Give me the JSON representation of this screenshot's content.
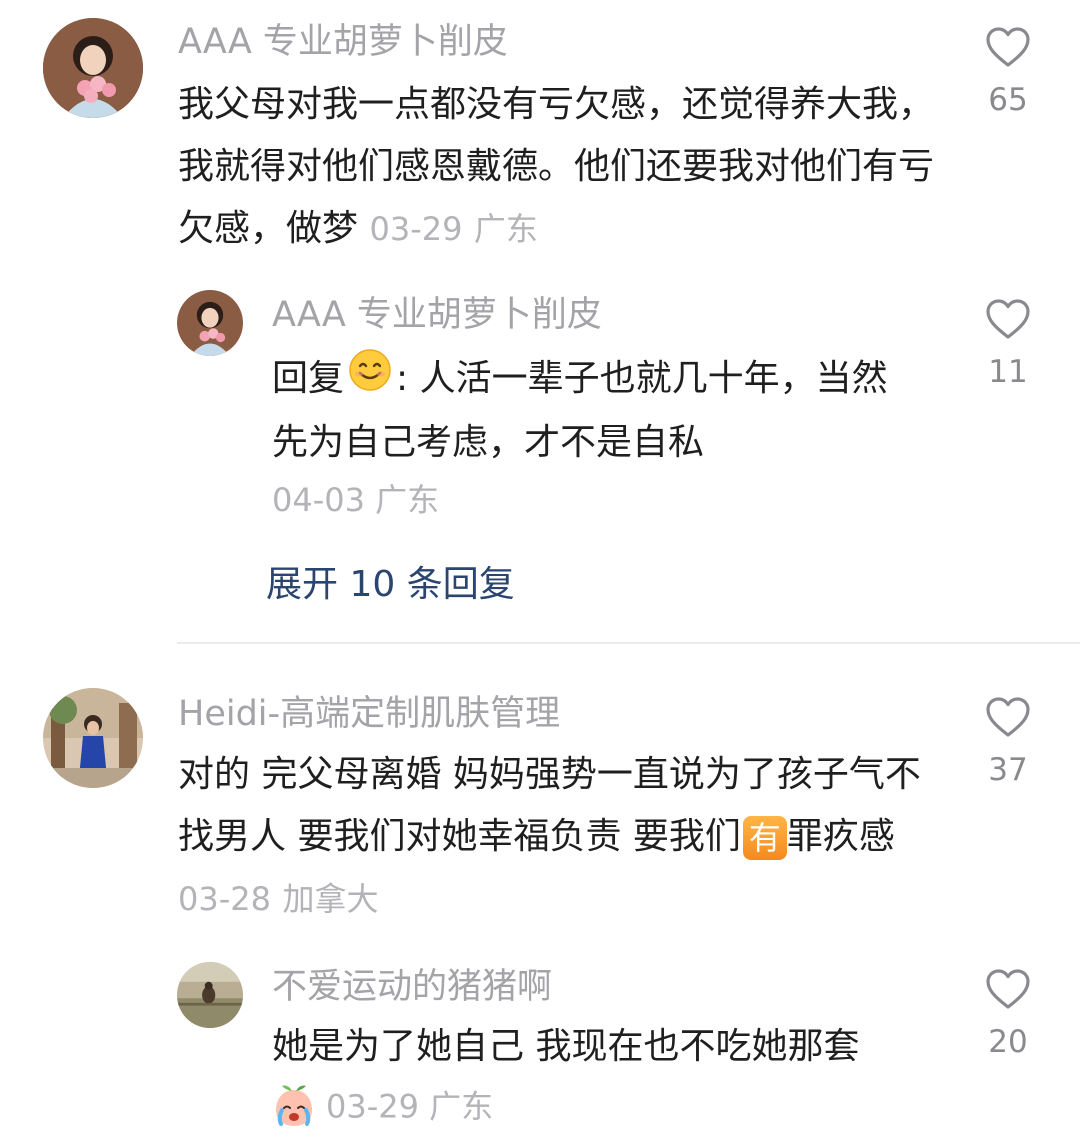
{
  "comments": [
    {
      "username": "AAA 专业胡萝卜削皮",
      "text": "我父母对我一点都没有亏欠感，还觉得养大我，我就得对他们感恩戴德。他们还要我对他们有亏欠感，做梦",
      "date": "03-29",
      "location": "广东",
      "likes": "65",
      "reply": {
        "username": "AAA 专业胡萝卜削皮",
        "prefix": "回复",
        "text": ": 人活一辈子也就几十年，当然先为自己考虑，才不是自私",
        "date": "04-03",
        "location": "广东",
        "likes": "11"
      },
      "expand_label": "展开 10 条回复"
    },
    {
      "username": "Heidi-高端定制肌肤管理",
      "text": "对的 完父母离婚 妈妈强势一直说为了孩子气不找男人 要我们对她幸福负责 要我们",
      "badge": "有",
      "text_end": "罪疚感",
      "date": "03-28",
      "location": "加拿大",
      "likes": "37",
      "reply": {
        "username": "不爱运动的猪猪啊",
        "text": "她是为了她自己 我现在也不吃她那套",
        "date": "03-29",
        "location": "广东",
        "likes": "20"
      }
    }
  ],
  "icons": {
    "like": "heart-outline-icon",
    "smile_emoji": "smiling-face-emoji",
    "crying_emoji": "crying-peach-emoji"
  },
  "colors": {
    "username": "#a3a3a8",
    "meta": "#b3b3b8",
    "link": "#2a4570",
    "badge": "#f58a1f"
  }
}
